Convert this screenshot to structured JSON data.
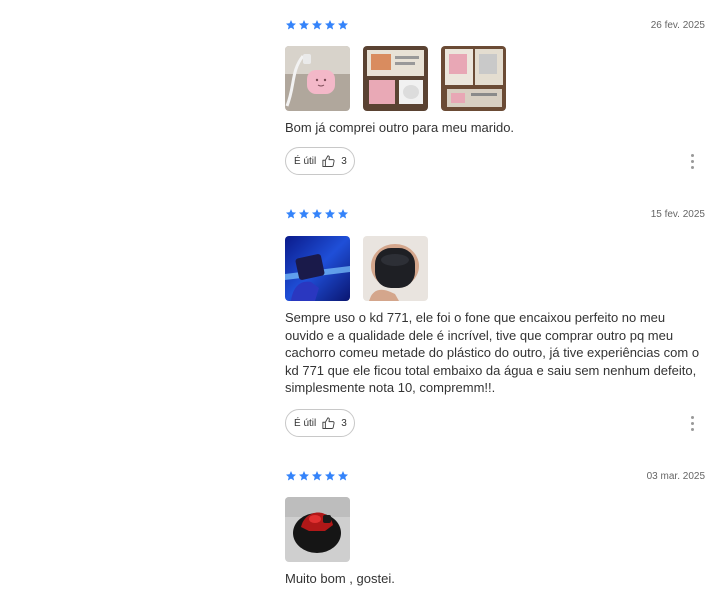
{
  "colors": {
    "star": "#3483fa",
    "text": "#333333",
    "muted": "#666666"
  },
  "reviews": [
    {
      "rating": 5,
      "date": "26 fev. 2025",
      "photos": [
        "pink earbuds case with cable",
        "earbuds package box",
        "earbuds package boxes"
      ],
      "text": "Bom já comprei outro para meu marido.",
      "useful_label": "É útil",
      "useful_count": "3"
    },
    {
      "rating": 5,
      "date": "15 fev. 2025",
      "photos": [
        "hand holding earbuds under blue light",
        "black earbuds case in hand"
      ],
      "text": "Sempre uso o kd 771, ele foi o fone que encaixou perfeito no meu ouvido e a qualidade dele é incrível, tive que comprar outro pq meu cachorro comeu metade do plástico do outro, já tive experiências com o kd 771 que ele ficou total embaixo da água e saiu sem nenhum defeito, simplesmente nota 10, compremm!!.",
      "useful_label": "É útil",
      "useful_count": "3"
    },
    {
      "rating": 5,
      "date": "03 mar. 2025",
      "photos": [
        "black and red earbuds case"
      ],
      "text": "Muito bom , gostei."
    }
  ]
}
